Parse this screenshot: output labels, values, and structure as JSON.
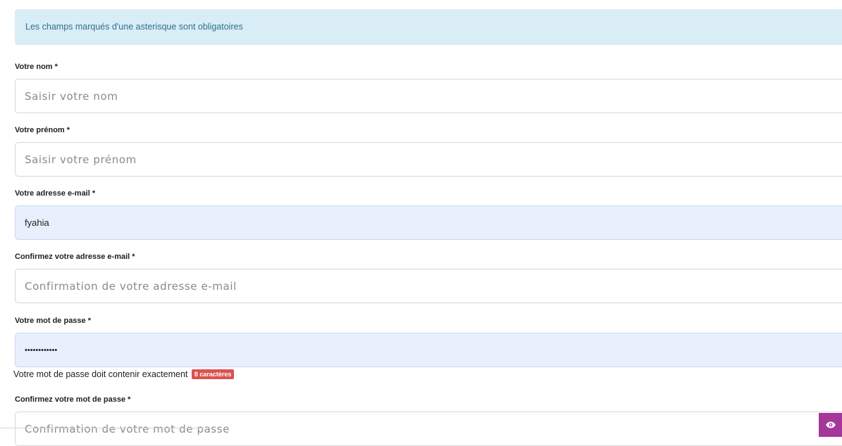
{
  "notice": "Les champs marqués d'une asterisque sont obligatoires",
  "fields": {
    "nom": {
      "label": "Votre nom *",
      "placeholder": "Saisir votre nom",
      "value": ""
    },
    "prenom": {
      "label": "Votre prénom *",
      "placeholder": "Saisir votre prénom",
      "value": ""
    },
    "email": {
      "label": "Votre adresse e-mail *",
      "placeholder": "",
      "value": "fyahia"
    },
    "email_confirm": {
      "label": "Confirmez votre adresse e-mail *",
      "placeholder": "Confirmation de votre adresse e-mail",
      "value": ""
    },
    "password": {
      "label": "Votre mot de passe *",
      "placeholder": "",
      "value": "••••••••••••"
    },
    "password_confirm": {
      "label": "Confirmez votre mot de passe *",
      "placeholder": "Confirmation de votre mot de passe",
      "value": ""
    }
  },
  "password_hint": {
    "text": "Votre mot de passe doit contenir exactement",
    "badge": "8 caractères"
  },
  "icons": {
    "toggle_visibility": "eye-icon"
  },
  "colors": {
    "notice_bg": "#d9edf7",
    "notice_text": "#31708f",
    "badge_bg": "#d9534f",
    "eye_button_bg": "#a43799",
    "autofill_bg": "#e8f0fe"
  }
}
